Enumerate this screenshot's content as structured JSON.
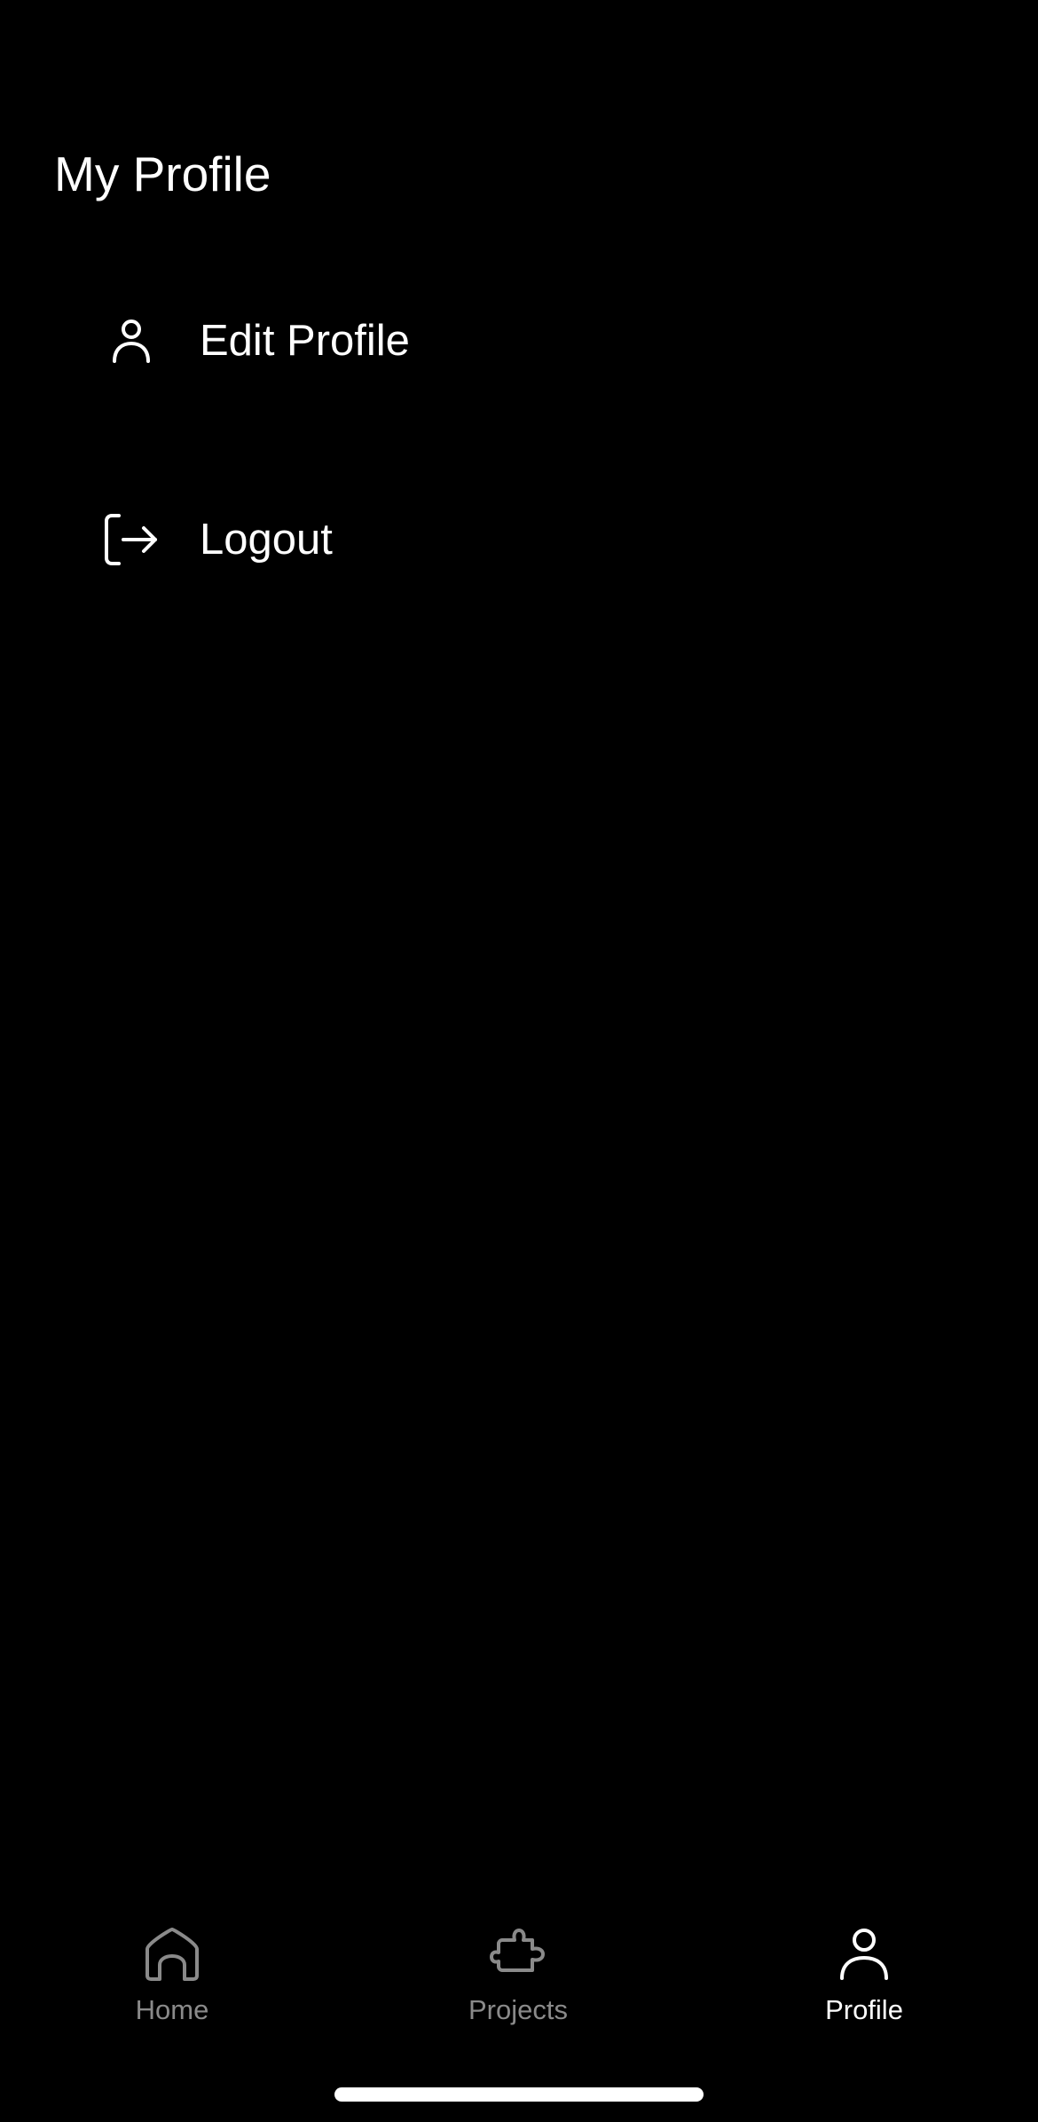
{
  "page": {
    "title": "My Profile"
  },
  "menu": {
    "items": [
      {
        "label": "Edit Profile",
        "icon": "user-icon"
      },
      {
        "label": "Logout",
        "icon": "logout-icon"
      }
    ]
  },
  "tabbar": {
    "tabs": [
      {
        "label": "Home",
        "icon": "home-icon",
        "active": false
      },
      {
        "label": "Projects",
        "icon": "puzzle-icon",
        "active": false
      },
      {
        "label": "Profile",
        "icon": "user-icon",
        "active": true
      }
    ]
  },
  "colors": {
    "background": "#000000",
    "text": "#ffffff",
    "inactive": "#8a8a8a",
    "active": "#ffffff"
  }
}
